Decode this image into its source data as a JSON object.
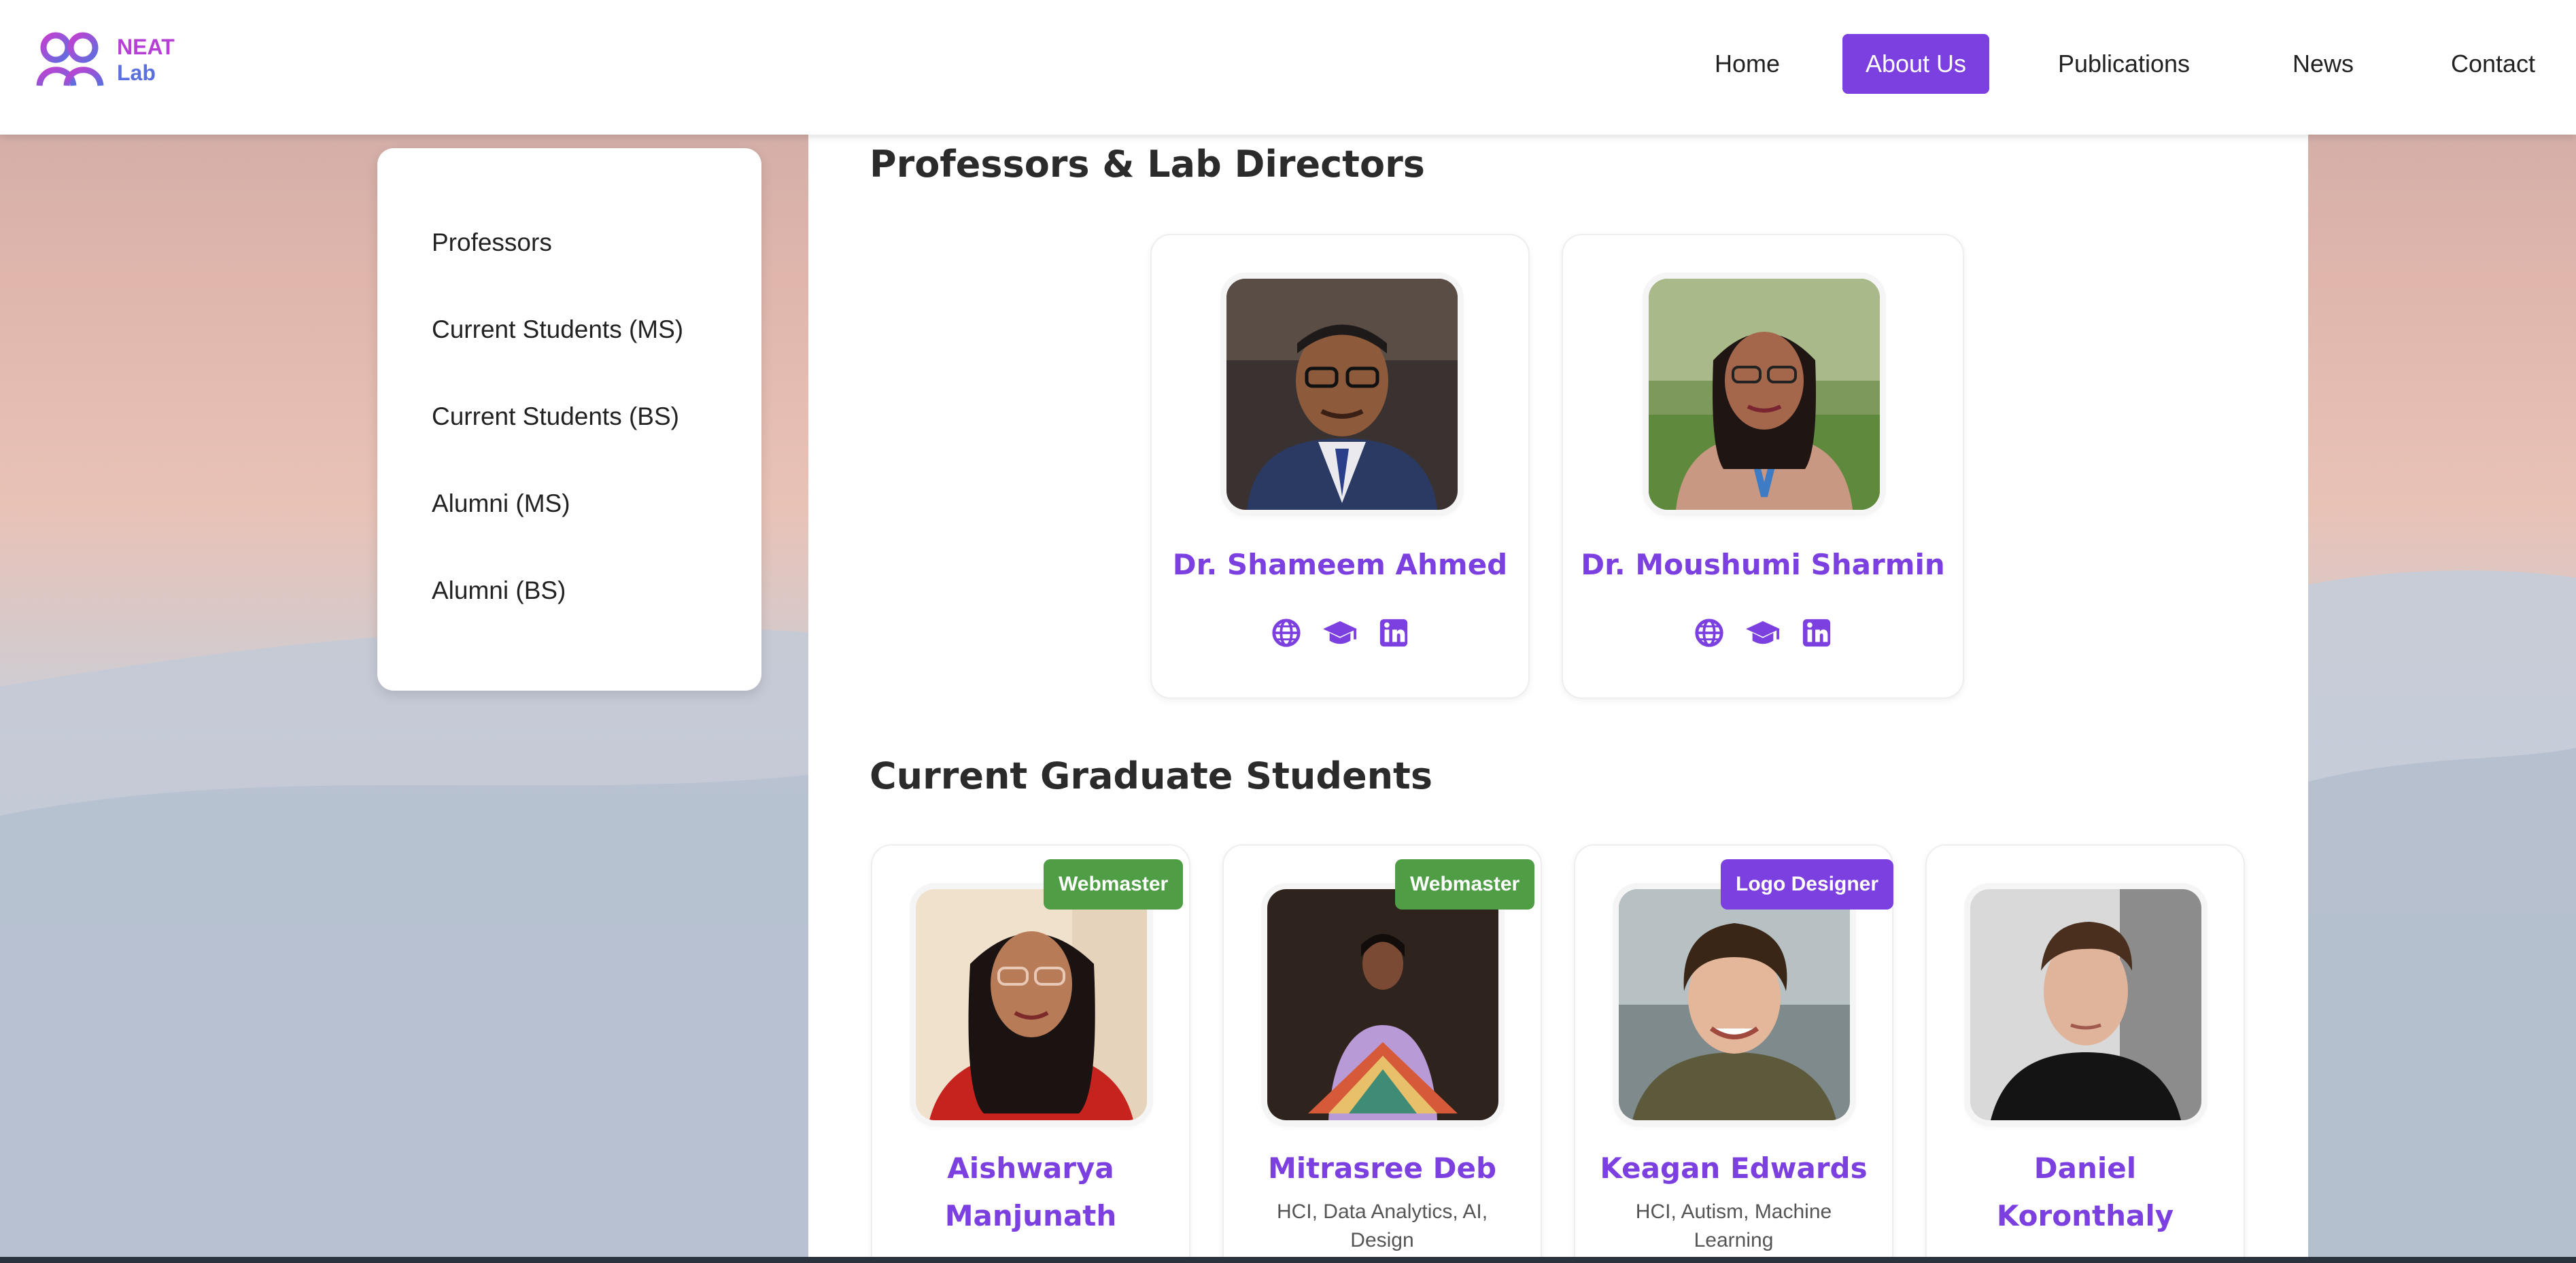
{
  "header": {
    "logo": {
      "line1": "NEAT",
      "line2": "Lab"
    },
    "nav": [
      {
        "label": "Home",
        "active": false
      },
      {
        "label": "About Us",
        "active": true
      },
      {
        "label": "Publications",
        "active": false
      },
      {
        "label": "News",
        "active": false
      },
      {
        "label": "Contact",
        "active": false
      }
    ]
  },
  "sidebar": {
    "items": [
      {
        "label": "Professors"
      },
      {
        "label": "Current Students (MS)"
      },
      {
        "label": "Current Students (BS)"
      },
      {
        "label": "Alumni (MS)"
      },
      {
        "label": "Alumni (BS)"
      }
    ]
  },
  "sections": {
    "professors": {
      "title": "Professors & Lab Directors",
      "people": [
        {
          "name": "Dr. Shameem Ahmed",
          "icons": [
            "globe-icon",
            "graduation-cap-icon",
            "linkedin-icon"
          ]
        },
        {
          "name": "Dr. Moushumi Sharmin",
          "icons": [
            "globe-icon",
            "graduation-cap-icon",
            "linkedin-icon"
          ]
        }
      ]
    },
    "grads": {
      "title": "Current Graduate Students",
      "people": [
        {
          "name_line1": "Aishwarya",
          "name_line2": "Manjunath",
          "badge": "Webmaster",
          "interests": ""
        },
        {
          "name_line1": "Mitrasree Deb",
          "name_line2": "",
          "badge": "Webmaster",
          "interests": "HCI, Data Analytics, AI, Design"
        },
        {
          "name_line1": "Keagan Edwards",
          "name_line2": "",
          "badge": "Logo Designer",
          "interests": "HCI, Autism, Machine Learning"
        },
        {
          "name_line1": "Daniel",
          "name_line2": "Koronthaly",
          "badge": "",
          "interests": ""
        }
      ]
    }
  },
  "colors": {
    "accent": "#7c3fe0",
    "badge_green": "#4f9e46",
    "badge_purple": "#7c3fe0",
    "nav_active_bg": "#7c3fe0"
  }
}
